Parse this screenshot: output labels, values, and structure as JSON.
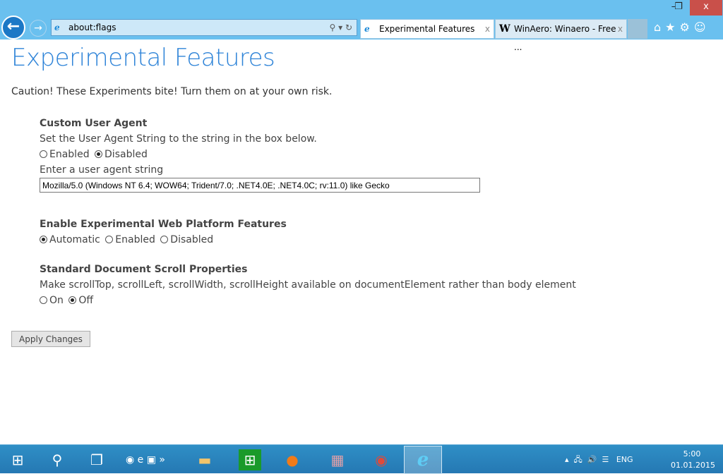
{
  "window": {
    "minimize": "–",
    "restore": "❐",
    "close": "x"
  },
  "address": {
    "url": "about:flags",
    "tools": "⚲ ▾ ↻"
  },
  "tabs": [
    {
      "label": "Experimental Features",
      "close": "x"
    },
    {
      "label": "WinAero: Winaero - Free ...",
      "close": "x"
    }
  ],
  "toolbar": {
    "icons": "⌂★⚙☺"
  },
  "page": {
    "title": "Experimental Features",
    "caution": "Caution! These Experiments bite! Turn them on at your own risk.",
    "sections": [
      {
        "title": "Custom User Agent",
        "desc": "Set the User Agent String to the string in the box below.",
        "options": [
          "Enabled",
          "Disabled"
        ],
        "selected": 1,
        "input_label": "Enter a user agent string",
        "input_value": "Mozilla/5.0 (Windows NT 6.4; WOW64; Trident/7.0; .NET4.0E; .NET4.0C; rv:11.0) like Gecko"
      },
      {
        "title": "Enable Experimental Web Platform Features",
        "options": [
          "Automatic",
          "Enabled",
          "Disabled"
        ],
        "selected": 0
      },
      {
        "title": "Standard Document Scroll Properties",
        "desc": "Make scrollTop, scrollLeft, scrollWidth, scrollHeight available on documentElement rather than body element",
        "options": [
          "On",
          "Off"
        ],
        "selected": 1
      }
    ],
    "apply": "Apply Changes"
  },
  "taskbar": {
    "lang": "ENG",
    "time": "5:00",
    "date": "01.01.2015"
  }
}
